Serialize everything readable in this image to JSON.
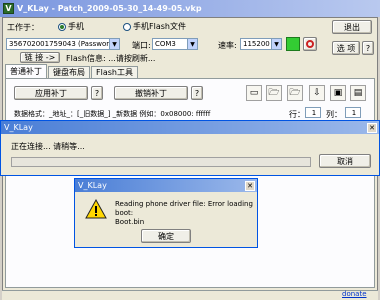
{
  "window": {
    "title": "V_KLay - Patch_2009-05-30_14-49-05.vkp"
  },
  "toolbar": {
    "work_label": "工作于：",
    "radio_phone": "手机",
    "radio_flash": "手机Flash文件",
    "exit_label": "退出",
    "device_value": "356702001759043 (Password Bi",
    "port_label": "端口:",
    "port_value": "COM3",
    "speed_label": "速率:",
    "speed_value": "115200",
    "options_label": "选 项",
    "help_label": "?",
    "connect_button": "链 接 ->",
    "flash_info": "Flash信息: ...请按刷新..."
  },
  "tabs": [
    "普通补丁",
    "键盘布局",
    "Flash工具"
  ],
  "patch": {
    "apply_label": "应用补丁",
    "revoke_label": "撤销补丁",
    "help_label": "?",
    "format_text": "数据格式：_地址_：[_旧数据_] _新数据 例如：0x08000: ffffff",
    "row_label": "行：",
    "row_value": "1",
    "col_label": "列：",
    "col_value": "1"
  },
  "progress_dialog": {
    "title": "V_KLay",
    "message": "正在连接... 请稍等...",
    "cancel_label": "取消"
  },
  "error_dialog": {
    "title": "V_KLay",
    "message_line1": "Reading phone driver file: Error loading boot:",
    "message_line2": "Boot.bin",
    "ok_label": "确定"
  },
  "footer": {
    "donate": "donate"
  },
  "colors": {
    "title_bar": "#7a96df",
    "connect_green": "#33cc33",
    "stop_red": "#cc2222"
  },
  "icons": [
    "new-file-icon",
    "open-folder-icon",
    "open-folder-2-icon",
    "import-icon",
    "save-icon",
    "save-as-icon",
    "warning-icon",
    "stop-icon"
  ]
}
